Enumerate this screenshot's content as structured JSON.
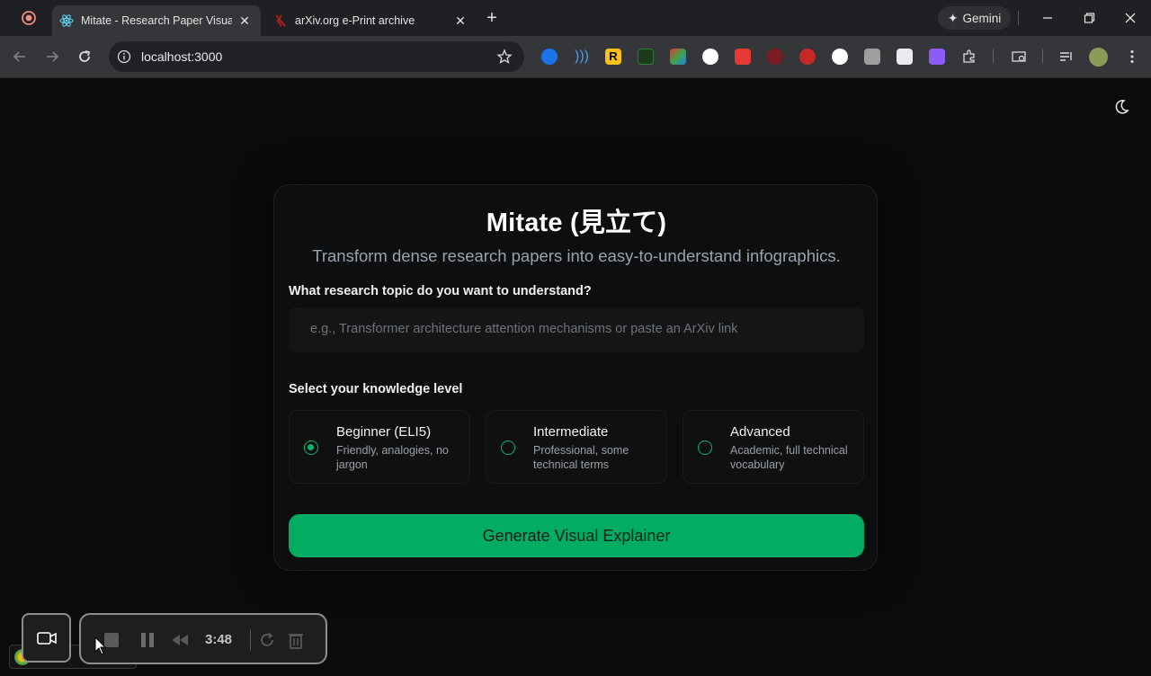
{
  "browser": {
    "tabs": [
      {
        "title": "Mitate - Research Paper Visual E",
        "active": true
      },
      {
        "title": "arXiv.org e-Print archive",
        "active": false
      }
    ],
    "gemini_label": "Gemini",
    "url": "localhost:3000"
  },
  "app": {
    "title": "Mitate (見立て)",
    "subtitle": "Transform dense research papers into easy-to-understand infographics.",
    "topic_label": "What research topic do you want to understand?",
    "topic_placeholder": "e.g., Transformer architecture attention mechanisms or paste an ArXiv link",
    "level_label": "Select your knowledge level",
    "levels": [
      {
        "title": "Beginner (ELI5)",
        "desc": "Friendly, analogies, no jargon",
        "selected": true
      },
      {
        "title": "Intermediate",
        "desc": "Professional, some technical terms",
        "selected": false
      },
      {
        "title": "Advanced",
        "desc": "Academic, full technical vocabulary",
        "selected": false
      }
    ],
    "generate_label": "Generate Visual Explainer"
  },
  "recorder": {
    "time": "3:48"
  },
  "colors": {
    "accent": "#02ad63",
    "background": "#0b0b0c",
    "card": "#0d0e10"
  }
}
